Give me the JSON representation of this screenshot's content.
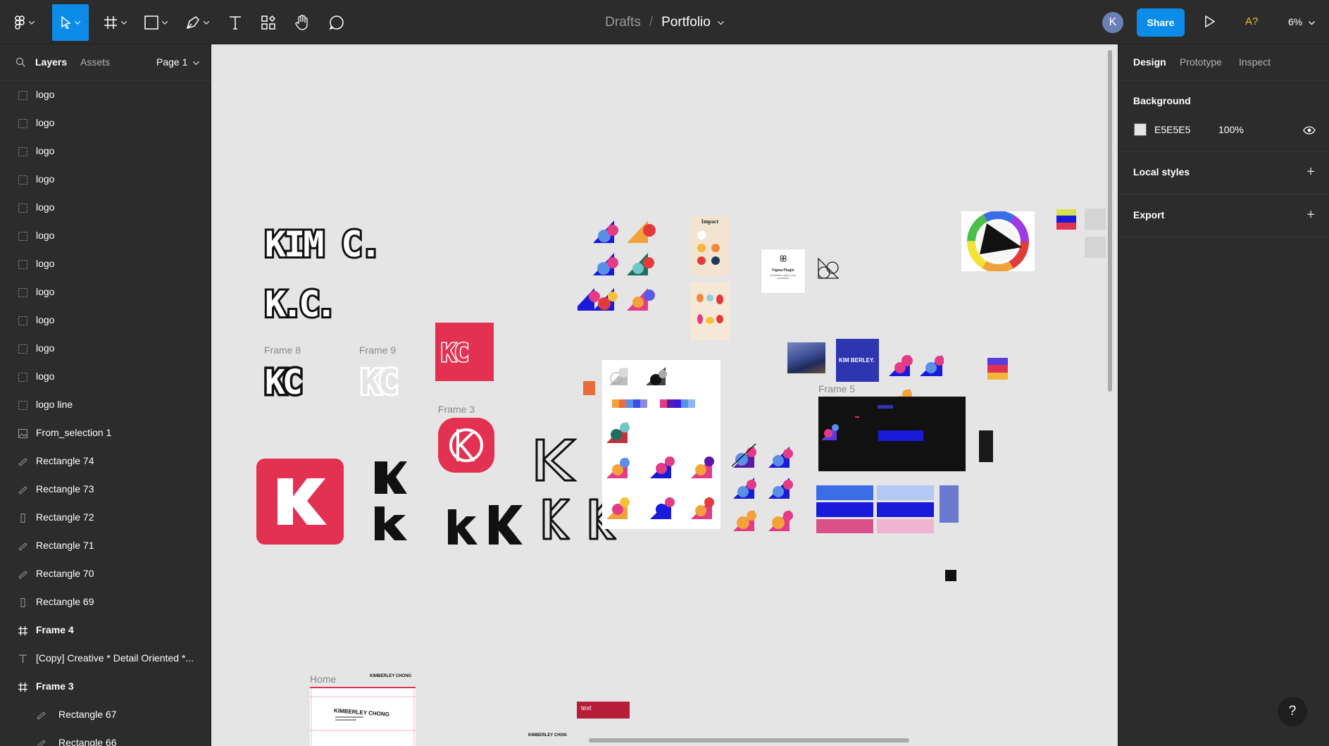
{
  "toolbar": {
    "breadcrumb_parent": "Drafts",
    "breadcrumb_separator": "/",
    "file_name": "Portfolio",
    "avatar_initial": "K",
    "share_label": "Share",
    "missing_fonts_label": "A?",
    "zoom_label": "6%",
    "tools": [
      "figma-menu-icon",
      "move-tool-icon",
      "frame-tool-icon",
      "shape-tool-icon",
      "pen-tool-icon",
      "text-tool-icon",
      "resources-icon",
      "hand-tool-icon",
      "comment-tool-icon"
    ],
    "accent_color": "#0c8ce9",
    "warning_color": "#f5bc2b"
  },
  "left_panel": {
    "tab_layers": "Layers",
    "tab_assets": "Assets",
    "page_label": "Page 1",
    "layers": [
      {
        "name": "logo",
        "icon": "group-dashed-icon",
        "indent": 0,
        "bold": false
      },
      {
        "name": "logo",
        "icon": "group-dashed-icon",
        "indent": 0,
        "bold": false
      },
      {
        "name": "logo",
        "icon": "group-dashed-icon",
        "indent": 0,
        "bold": false
      },
      {
        "name": "logo",
        "icon": "group-dashed-icon",
        "indent": 0,
        "bold": false
      },
      {
        "name": "logo",
        "icon": "group-dashed-icon",
        "indent": 0,
        "bold": false
      },
      {
        "name": "logo",
        "icon": "group-dashed-icon",
        "indent": 0,
        "bold": false
      },
      {
        "name": "logo",
        "icon": "group-dashed-icon",
        "indent": 0,
        "bold": false
      },
      {
        "name": "logo",
        "icon": "group-dashed-icon",
        "indent": 0,
        "bold": false
      },
      {
        "name": "logo",
        "icon": "group-dashed-icon",
        "indent": 0,
        "bold": false
      },
      {
        "name": "logo",
        "icon": "group-dashed-icon",
        "indent": 0,
        "bold": false
      },
      {
        "name": "logo",
        "icon": "group-dashed-icon",
        "indent": 0,
        "bold": false
      },
      {
        "name": "logo line",
        "icon": "group-dashed-icon",
        "indent": 0,
        "bold": false
      },
      {
        "name": "From_selection 1",
        "icon": "image-icon",
        "indent": 0,
        "bold": false
      },
      {
        "name": "Rectangle 74",
        "icon": "rotated-rect-icon",
        "indent": 0,
        "bold": false
      },
      {
        "name": "Rectangle 73",
        "icon": "rotated-rect-icon",
        "indent": 0,
        "bold": false
      },
      {
        "name": "Rectangle 72",
        "icon": "vertical-rect-icon",
        "indent": 0,
        "bold": false
      },
      {
        "name": "Rectangle 71",
        "icon": "rotated-rect-icon",
        "indent": 0,
        "bold": false
      },
      {
        "name": "Rectangle 70",
        "icon": "rotated-rect-icon",
        "indent": 0,
        "bold": false
      },
      {
        "name": "Rectangle 69",
        "icon": "vertical-rect-icon",
        "indent": 0,
        "bold": false
      },
      {
        "name": "Frame 4",
        "icon": "frame-icon",
        "indent": 0,
        "bold": true
      },
      {
        "name": "[Copy] Creative * Detail Oriented *...",
        "icon": "text-icon",
        "indent": 0,
        "bold": false
      },
      {
        "name": "Frame 3",
        "icon": "frame-icon",
        "indent": 0,
        "bold": true
      },
      {
        "name": "Rectangle 67",
        "icon": "rotated-rect-icon",
        "indent": 1,
        "bold": false
      },
      {
        "name": "Rectangle 66",
        "icon": "rotated-rect-icon",
        "indent": 1,
        "bold": false
      }
    ]
  },
  "canvas": {
    "background": "#e5e5e5",
    "frame_labels": {
      "frame8": "Frame 8",
      "frame9": "Frame 9",
      "frame3": "Frame 3",
      "frame5": "Frame 5",
      "home": "Home"
    },
    "logo_texts": {
      "kim_c": "KIM C.",
      "kc_dots": "K.C.",
      "kc_frame8": "KC",
      "kc_frame9": "KC",
      "kc_red": "KC"
    },
    "impact_title": "Impact",
    "plugin_card_title": "Figma Plugin",
    "plugin_card_desc": "All palettes right in your workspace",
    "kim_berley_card": "KIM BERLEY.",
    "home_header": "KIMBERLEY CHONG",
    "home_title": "KIMBERLEY CHONG",
    "red_label_text": "text",
    "bottom_logo_text": "KIMBERLEY CHON",
    "brand_red": "#e33152",
    "brand_blue": "#1a1adb"
  },
  "right_panel": {
    "tab_design": "Design",
    "tab_prototype": "Prototype",
    "tab_inspect": "Inspect",
    "background_title": "Background",
    "background_hex": "E5E5E5",
    "background_opacity": "100%",
    "local_styles_title": "Local styles",
    "export_title": "Export",
    "help_label": "?"
  }
}
